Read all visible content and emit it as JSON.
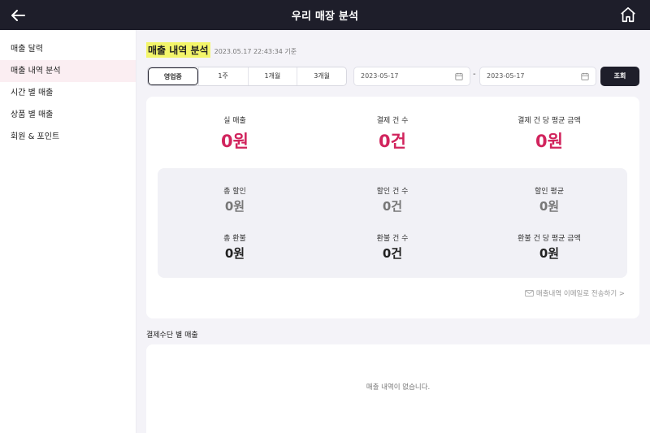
{
  "header": {
    "title": "우리 매장 분석"
  },
  "sidebar": {
    "items": [
      {
        "label": "매출 달력"
      },
      {
        "label": "매출 내역 분석",
        "active": true
      },
      {
        "label": "시간 별 매출"
      },
      {
        "label": "상품 별 매출"
      },
      {
        "label": "회원 & 포인트"
      }
    ]
  },
  "main": {
    "title": "매출 내역 분석",
    "timestamp": "2023.05.17 22:43:34 기준",
    "periods": [
      "영업중",
      "1주",
      "1개월",
      "3개월"
    ],
    "active_period": "영업중",
    "date_from": "2023-05-17",
    "date_to": "2023-05-17",
    "date_separator": "-",
    "query_label": "조회",
    "summary": [
      {
        "label": "실 매출",
        "value": "0원"
      },
      {
        "label": "결제 건 수",
        "value": "0건"
      },
      {
        "label": "결제 건 당 평균 금액",
        "value": "0원"
      }
    ],
    "details": [
      {
        "label": "총 할인",
        "value": "0원"
      },
      {
        "label": "할인 건 수",
        "value": "0건"
      },
      {
        "label": "할인 평균",
        "value": "0원"
      },
      {
        "label": "총 환불",
        "value": "0원"
      },
      {
        "label": "환불 건 수",
        "value": "0건"
      },
      {
        "label": "환불 건 당 평균 금액",
        "value": "0원"
      }
    ],
    "email_link": "매출내역 이메일로 전송하기 >",
    "payment_section_title": "결제수단 별 매출",
    "empty_text": "매출 내역이 없습니다."
  },
  "colors": {
    "accent": "#d1245d",
    "dark": "#1e1e2a",
    "highlight": "#f3f56a"
  },
  "icons": {
    "back": "arrow-left-icon",
    "home": "home-icon",
    "calendar": "calendar-icon",
    "mail": "envelope-icon"
  }
}
